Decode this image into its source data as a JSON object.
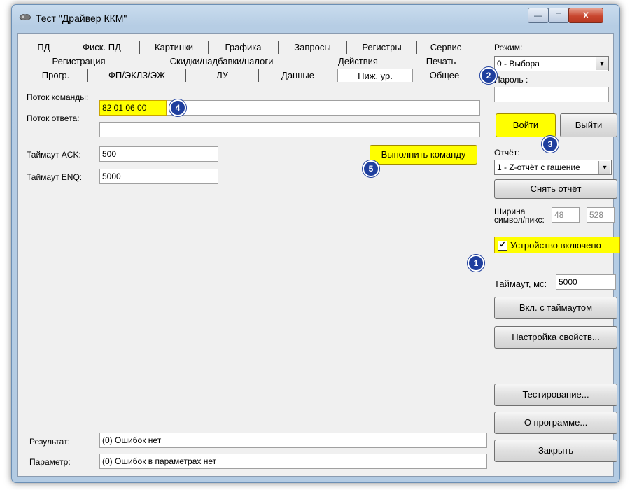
{
  "window": {
    "title": "Тест \"Драйвер ККМ\"",
    "min_label": "—",
    "max_label": "□",
    "close_label": "X"
  },
  "tabs": {
    "row1": [
      "ПД",
      "Фиск. ПД",
      "Картинки",
      "Графика",
      "Запросы",
      "Регистры",
      "Сервис"
    ],
    "row2": [
      "Регистрация",
      "Скидки/надбавки/налоги",
      "Действия",
      "Печать"
    ],
    "row3": [
      "Прогр.",
      "ФП/ЭКЛЗ/ЭЖ",
      "ЛУ",
      "Данные",
      "Ниж. ур.",
      "Общее"
    ],
    "active": "Ниж. ур."
  },
  "main": {
    "command_label": "Поток команды:",
    "command_value": "82 01 06 00",
    "response_label": "Поток ответа:",
    "response_value": "",
    "ack_label": "Таймаут ACK:",
    "ack_value": "500",
    "enq_label": "Таймаут ENQ:",
    "enq_value": "5000",
    "execute_label": "Выполнить команду",
    "result_label": "Результат:",
    "result_value": "(0) Ошибок нет",
    "param_label": "Параметр:",
    "param_value": "(0) Ошибок в параметрах нет"
  },
  "right": {
    "mode_label": "Режим:",
    "mode_value": "0 - Выбора",
    "password_label": "Пароль :",
    "password_value": "",
    "login_label": "Войти",
    "logout_label": "Выйти",
    "report_label": "Отчёт:",
    "report_value": "1 - Z-отчёт с гашение",
    "take_report_label": "Снять отчёт",
    "width_label": "Ширина символ/пикс:",
    "width_chars": "48",
    "width_pixels": "528",
    "device_on_label": "Устройство включено",
    "device_on_checked": true,
    "timeout_label": "Таймаут, мс:",
    "timeout_value": "5000",
    "enable_timeout_label": "Вкл. с таймаутом",
    "settings_label": "Настройка свойств...",
    "testing_label": "Тестирование...",
    "about_label": "О программе...",
    "close_label": "Закрыть"
  },
  "badges": [
    "1",
    "2",
    "3",
    "4",
    "5"
  ],
  "colors": {
    "highlight": "#ffff00",
    "badge": "#1f3f9e",
    "title_bar": "#b6cde4"
  }
}
